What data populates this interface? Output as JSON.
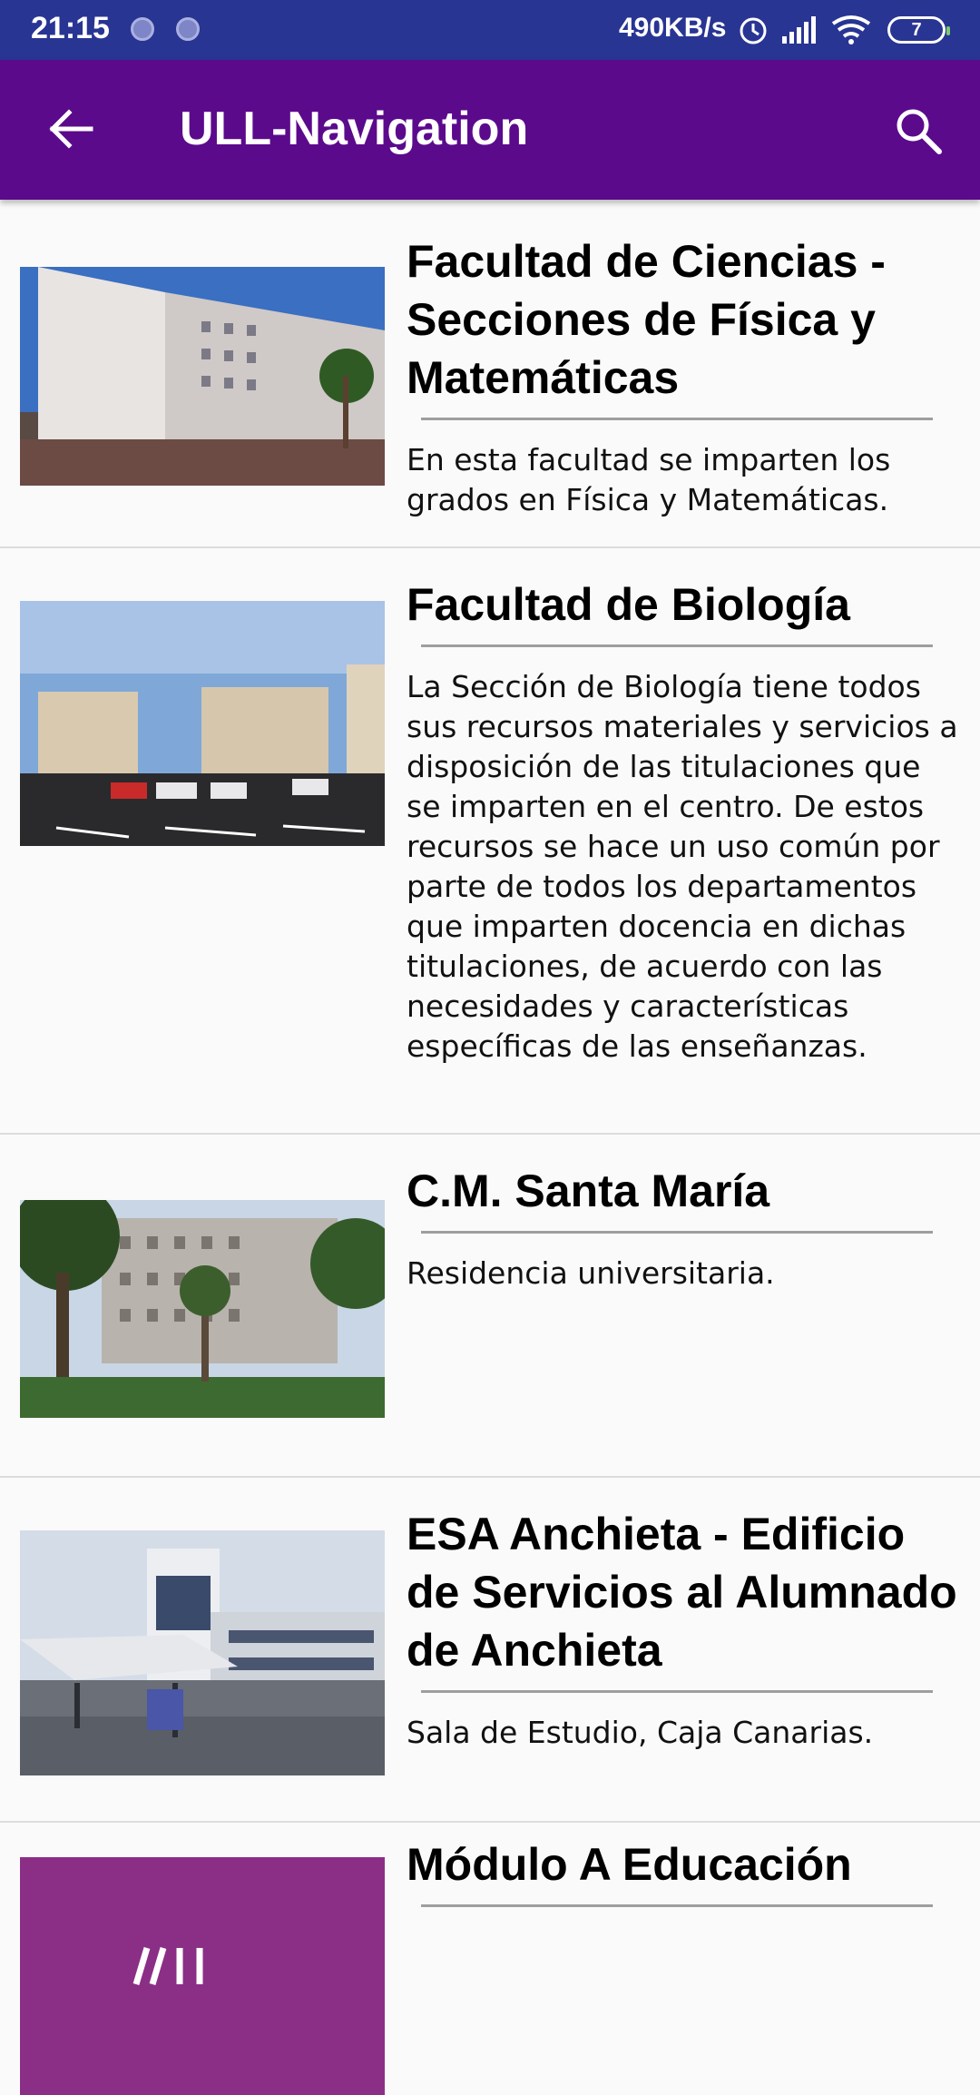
{
  "status_bar": {
    "time": "21:15",
    "net_speed": "490KB/s",
    "battery_level": "7",
    "icons": [
      "notification-dot-icon",
      "notification-dot-icon",
      "alarm-icon",
      "signal-icon",
      "wifi-icon",
      "battery-icon"
    ]
  },
  "app_bar": {
    "title": "ULL-Navigation",
    "back_icon": "arrow-back-icon",
    "search_icon": "search-icon",
    "color": "#5b0a8c"
  },
  "places": [
    {
      "title": "Facultad de Ciencias - Secciones de Física y Matemáticas",
      "description": "En esta facultad se imparten los grados en Física y Matemáticas."
    },
    {
      "title": "Facultad de Biología",
      "description": "La Sección de Biología tiene todos sus recursos materiales y servicios a disposición de las titulaciones que se imparten en el centro. De estos recursos se hace un uso común por parte de todos los departamentos que imparten docencia en dichas titulaciones, de acuerdo con las necesidades y características específicas de las enseñanzas."
    },
    {
      "title": "C.M. Santa María",
      "description": "Residencia universitaria."
    },
    {
      "title": "ESA Anchieta - Edificio de Servicios al Alumnado de Anchieta",
      "description": "Sala de Estudio, Caja Canarias."
    },
    {
      "title": "Módulo A Educación",
      "description": ""
    }
  ]
}
